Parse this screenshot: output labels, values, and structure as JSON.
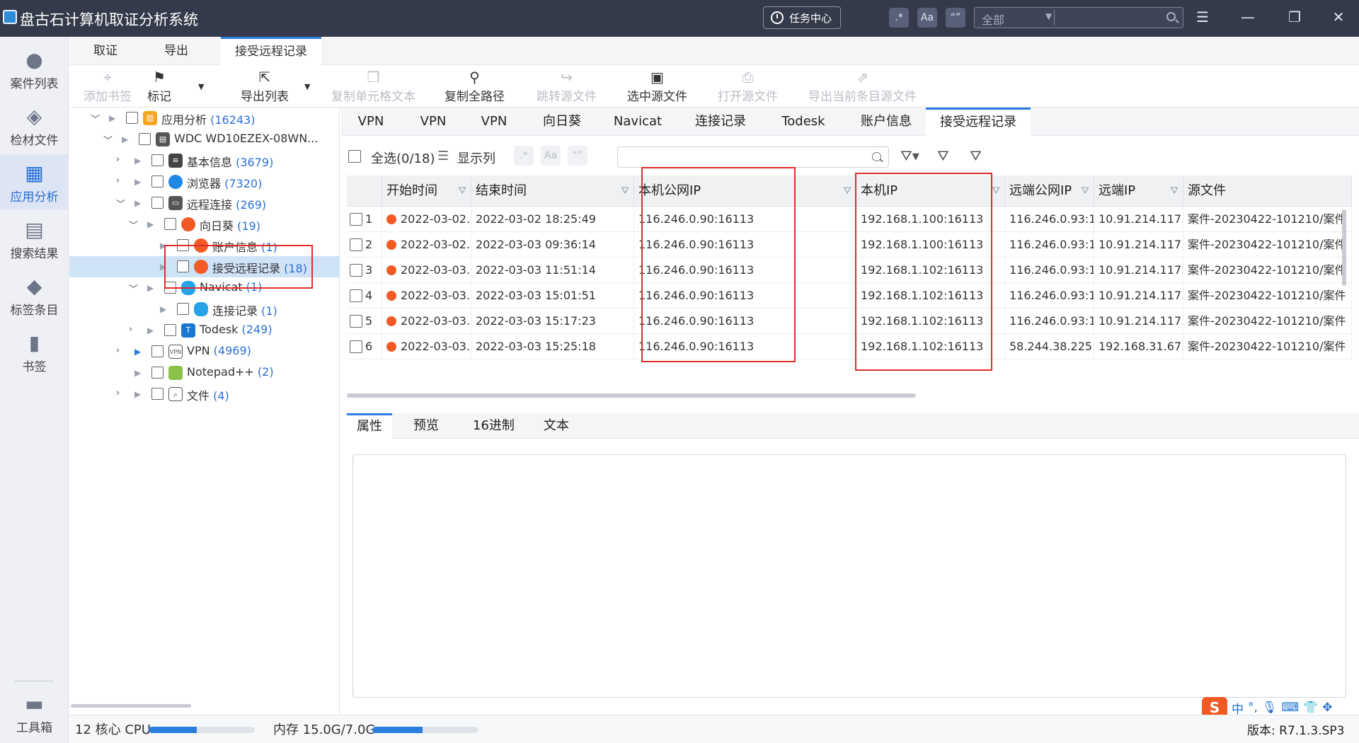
{
  "titlebar": {
    "title": "盘古石计算机取证分析系统",
    "task_center": "任务中心",
    "toggle_regex": ".*",
    "toggle_case": "Aa",
    "toggle_word": "“”",
    "search_scope": "全部"
  },
  "nav": {
    "items": [
      "案件列表",
      "检材文件",
      "应用分析",
      "搜索结果",
      "标签条目",
      "书签"
    ],
    "toolbox": "工具箱"
  },
  "ribbon": {
    "tabs": [
      "取证",
      "导出",
      "接受远程记录"
    ],
    "tools": [
      "添加书签",
      "标记",
      "导出列表",
      "复制单元格文本",
      "复制全路径",
      "跳转源文件",
      "选中源文件",
      "打开源文件",
      "导出当前条目源文件"
    ]
  },
  "tree": [
    {
      "label": "应用分析",
      "count": "(16243)"
    },
    {
      "label": "WDC WD10EZEX-08WN...",
      "count": ""
    },
    {
      "label": "基本信息",
      "count": "(3679)"
    },
    {
      "label": "浏览器",
      "count": "(7320)"
    },
    {
      "label": "远程连接",
      "count": "(269)"
    },
    {
      "label": "向日葵",
      "count": "(19)"
    },
    {
      "label": "账户信息",
      "count": "(1)"
    },
    {
      "label": "接受远程记录",
      "count": "(18)"
    },
    {
      "label": "Navicat",
      "count": "(1)"
    },
    {
      "label": "连接记录",
      "count": "(1)"
    },
    {
      "label": "Todesk",
      "count": "(249)"
    },
    {
      "label": "VPN",
      "count": "(4969)"
    },
    {
      "label": "Notepad++",
      "count": "(2)"
    },
    {
      "label": "文件",
      "count": "(4)"
    }
  ],
  "category_tabs": [
    "VPN",
    "VPN",
    "VPN",
    "向日葵",
    "Navicat",
    "连接记录",
    "Todesk",
    "账户信息",
    "接受远程记录"
  ],
  "grid_toolbar": {
    "select_all": "全选(0/18)",
    "show_columns": "显示列"
  },
  "grid": {
    "columns": [
      "开始时间",
      "结束时间",
      "本机公网IP",
      "本机IP",
      "远端公网IP",
      "远端IP",
      "源文件"
    ],
    "rows": [
      {
        "n": "1",
        "start": "2022-03-02...",
        "end": "2022-03-02 18:25:49",
        "pub": "116.246.0.90:16113",
        "ip": "192.168.1.100:16113",
        "rpub": "116.246.0.93:1...",
        "rip": "10.91.214.117...",
        "src": "案件-20230422-101210/案件"
      },
      {
        "n": "2",
        "start": "2022-03-02...",
        "end": "2022-03-03 09:36:14",
        "pub": "116.246.0.90:16113",
        "ip": "192.168.1.100:16113",
        "rpub": "116.246.0.93:1...",
        "rip": "10.91.214.117...",
        "src": "案件-20230422-101210/案件"
      },
      {
        "n": "3",
        "start": "2022-03-03...",
        "end": "2022-03-03 11:51:14",
        "pub": "116.246.0.90:16113",
        "ip": "192.168.1.102:16113",
        "rpub": "116.246.0.93:1...",
        "rip": "10.91.214.117...",
        "src": "案件-20230422-101210/案件"
      },
      {
        "n": "4",
        "start": "2022-03-03...",
        "end": "2022-03-03 15:01:51",
        "pub": "116.246.0.90:16113",
        "ip": "192.168.1.102:16113",
        "rpub": "116.246.0.93:1...",
        "rip": "10.91.214.117...",
        "src": "案件-20230422-101210/案件"
      },
      {
        "n": "5",
        "start": "2022-03-03...",
        "end": "2022-03-03 15:17:23",
        "pub": "116.246.0.90:16113",
        "ip": "192.168.1.102:16113",
        "rpub": "116.246.0.93:1...",
        "rip": "10.91.214.117...",
        "src": "案件-20230422-101210/案件"
      },
      {
        "n": "6",
        "start": "2022-03-03...",
        "end": "2022-03-03 15:25:18",
        "pub": "116.246.0.90:16113",
        "ip": "192.168.1.102:16113",
        "rpub": "58.244.38.225:...",
        "rip": "192.168.31.67...",
        "src": "案件-20230422-101210/案件"
      }
    ]
  },
  "detail_tabs": [
    "属性",
    "预览",
    "16进制",
    "文本"
  ],
  "status": {
    "cpu": "12 核心 CPU",
    "cpu_usage": 0.45,
    "mem": "内存 15.0G/7.0G",
    "mem_usage": 0.47,
    "version": "版本: R7.1.3.SP3"
  },
  "ime": {
    "lang": "中",
    "punct": "°,",
    "logo": "S"
  },
  "colors": {
    "accent": "#2a7de1",
    "titlebar": "#343a4a",
    "highlight": "#e02b2b",
    "sunlogin": "#f15a24"
  }
}
